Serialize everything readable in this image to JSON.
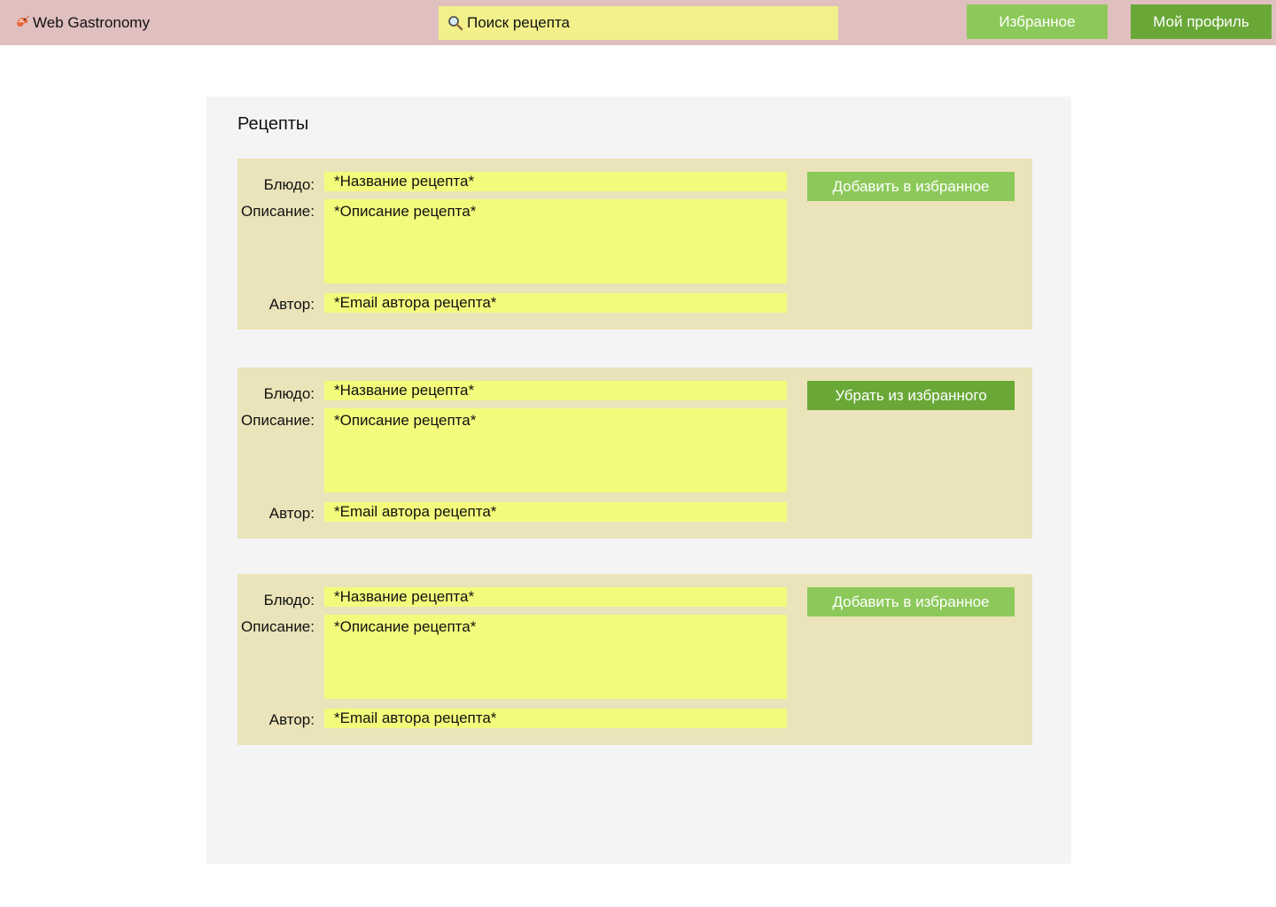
{
  "header": {
    "brand": "Web Gastronomy",
    "search_placeholder": "Поиск рецепта",
    "favorites_label": "Избранное",
    "profile_label": "Мой профиль"
  },
  "page": {
    "title": "Рецепты"
  },
  "labels": {
    "dish": "Блюдо:",
    "description": "Описание:",
    "author": "Автор:"
  },
  "recipes": [
    {
      "name": "*Название рецепта*",
      "description": "*Описание рецепта*",
      "author": "*Email автора рецепта*",
      "action": "Добавить в избранное"
    },
    {
      "name": "*Название рецепта*",
      "description": "*Описание рецепта*",
      "author": "*Email автора рецепта*",
      "action": "Убрать из избранного"
    },
    {
      "name": "*Название рецепта*",
      "description": "*Описание рецепта*",
      "author": "*Email автора рецепта*",
      "action": "Добавить в избранное"
    }
  ],
  "icons": {
    "brand": "shrimp-icon",
    "search": "magnifier-icon"
  },
  "colors": {
    "header_bg": "#e0bfbf",
    "search_bg": "#f2f08a",
    "button_light_green": "#8cc95a",
    "button_dark_green": "#69a837",
    "card_bg": "#ebe3b9",
    "field_bg": "#f4fb7c",
    "panel_bg": "#f4f4f4"
  }
}
